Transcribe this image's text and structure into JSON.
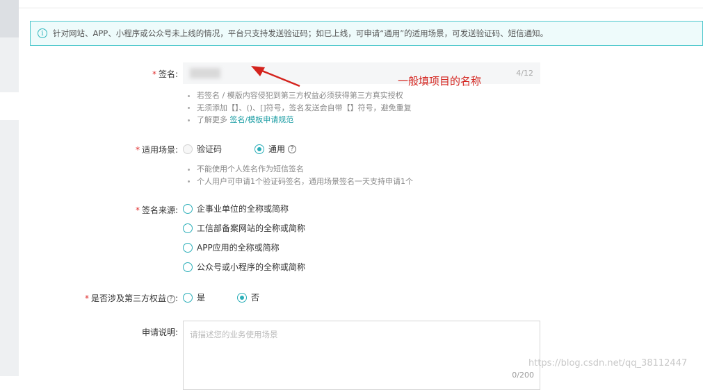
{
  "notice": {
    "text": "针对网站、APP、小程序或公众号未上线的情况，平台只支持发送验证码；如已上线，可申请“通用”的适用场景，可发送验证码、短信通知。",
    "icon": "info-icon"
  },
  "required_mark": "*",
  "signature": {
    "label": "签名:",
    "value": "",
    "counter": "4/12",
    "hints": [
      "若签名 / 模版内容侵犯到第三方权益必须获得第三方真实授权",
      "无须添加【】、()、[]符号，签名发送会自带【】符号，避免重复"
    ],
    "learn_more_prefix": "了解更多",
    "learn_more_link": "签名/模板申请规范"
  },
  "annotation": {
    "text": "一般填项目的名称",
    "color": "#d4231d"
  },
  "scenario": {
    "label": "适用场景:",
    "options": [
      {
        "label": "验证码",
        "selected": false,
        "disabled": true
      },
      {
        "label": "通用",
        "selected": true,
        "disabled": false
      }
    ],
    "help_icon": "?",
    "hints": [
      "不能使用个人姓名作为短信签名",
      "个人用户可申请1个验证码签名，通用场景签名一天支持申请1个"
    ]
  },
  "source": {
    "label": "签名来源:",
    "options": [
      "企事业单位的全称或简称",
      "工信部备案网站的全称或简称",
      "APP应用的全称或简称",
      "公众号或小程序的全称或简称"
    ]
  },
  "third_party": {
    "label": "是否涉及第三方权益",
    "help_icon": "?",
    "colon": ":",
    "options": [
      {
        "label": "是",
        "selected": false
      },
      {
        "label": "否",
        "selected": true
      }
    ]
  },
  "description": {
    "label": "申请说明:",
    "placeholder": "请描述您的业务使用场景",
    "counter": "0/200"
  },
  "watermark": "https://blog.csdn.net/qq_38112447",
  "colors": {
    "accent": "#2aaeb8",
    "required": "#e03030",
    "notice_border": "#4cc7cc"
  }
}
